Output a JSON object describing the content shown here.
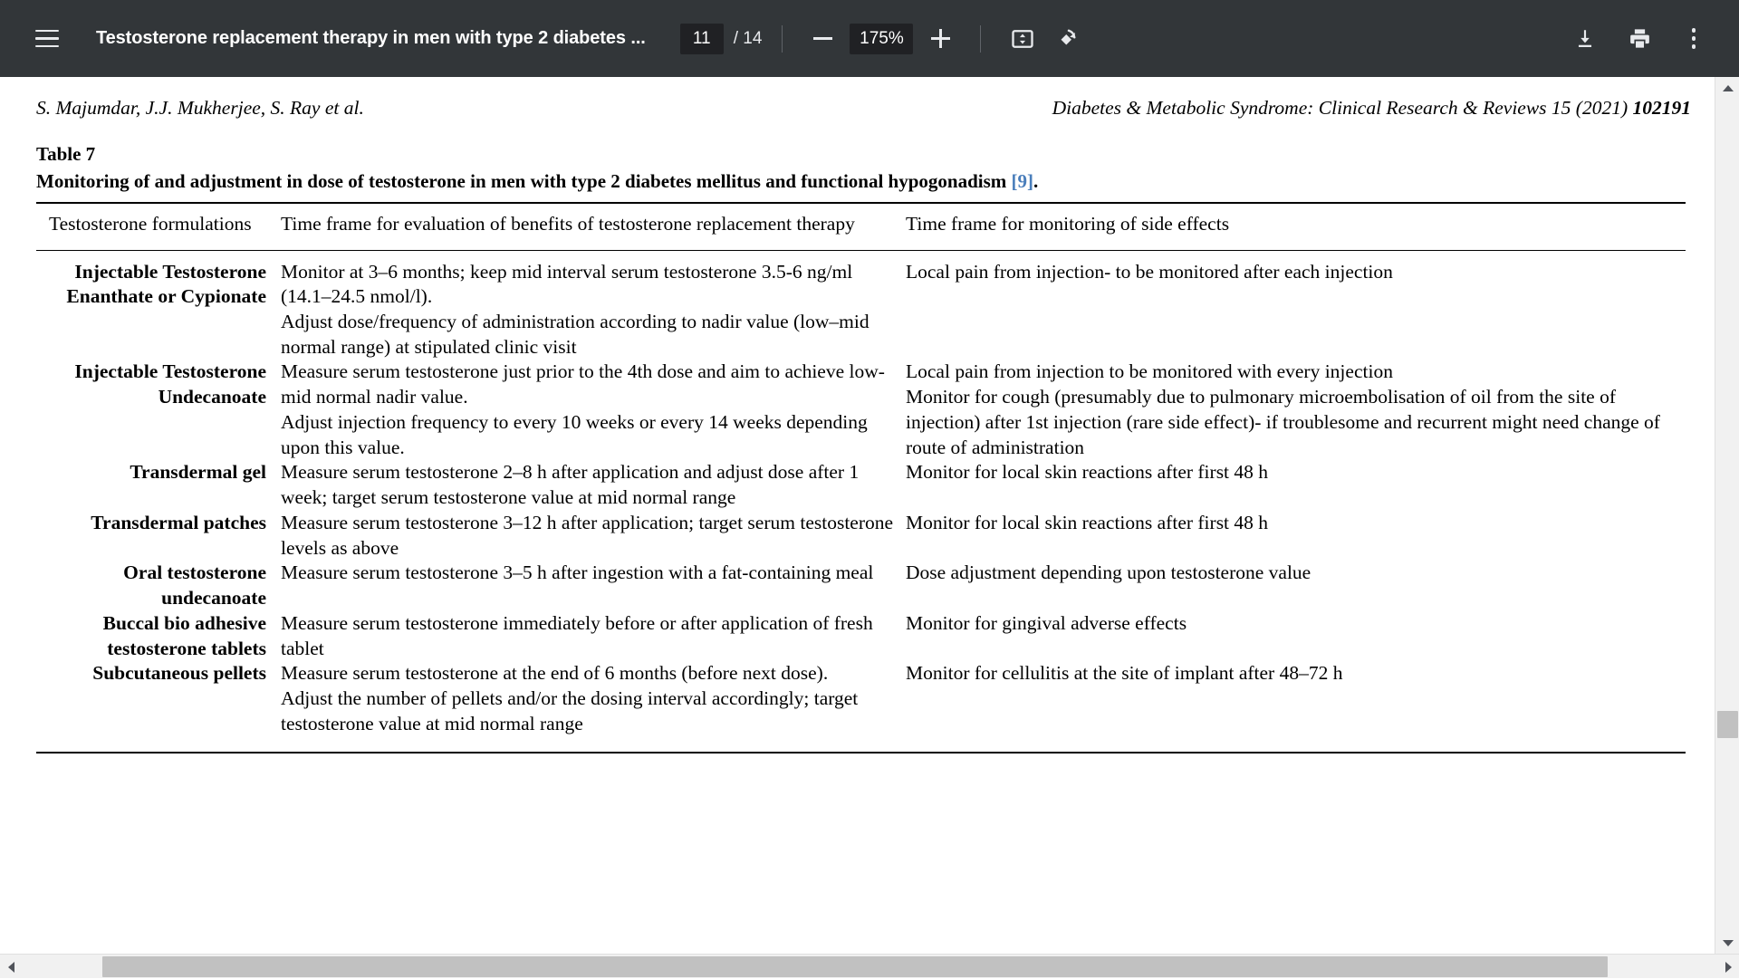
{
  "toolbar": {
    "menu_icon": "hamburger-menu-icon",
    "document_title": "Testosterone replacement therapy in men with type 2 diabetes ...",
    "page_number": "11",
    "page_count_label": "/ 14",
    "zoom_out_icon": "minus-icon",
    "zoom_level": "175%",
    "zoom_in_icon": "plus-icon",
    "fit_icon": "fit-to-page-icon",
    "rotate_icon": "rotate-icon",
    "download_icon": "download-icon",
    "print_icon": "print-icon",
    "more_icon": "kebab-more-icon",
    "background_color": "#323639",
    "field_background_color": "#202124"
  },
  "document": {
    "running_head": {
      "authors": "S. Majumdar, J.J. Mukherjee, S. Ray et al.",
      "journal_plain": "Diabetes & Metabolic Syndrome: Clinical Research & Reviews 15 (2021) ",
      "journal_article_id": "102191"
    },
    "table_label": "Table 7",
    "caption_text": "Monitoring of and adjustment in dose of testosterone in men with type 2 diabetes mellitus and functional hypogonadism ",
    "caption_reference": "[9]",
    "caption_suffix": ".",
    "reference_link_color": "#4a7ebb",
    "table": {
      "headers": [
        "Testosterone formulations",
        "Time frame for evaluation of benefits of testosterone replacement therapy",
        "Time frame for monitoring of side effects"
      ],
      "rows": [
        {
          "formulation": "Injectable Testosterone Enanthate or Cypionate",
          "benefit": "Monitor at 3–6 months; keep mid interval serum testosterone 3.5-6 ng/ml (14.1–24.5 nmol/l).\nAdjust dose/frequency of administration according to nadir value (low–mid normal range) at stipulated clinic visit",
          "side_effect": "Local pain from injection- to be monitored after each injection"
        },
        {
          "formulation": "Injectable Testosterone Undecanoate",
          "benefit": "Measure serum testosterone just prior to the 4th dose and aim to achieve low-mid normal nadir value.\nAdjust injection frequency to every 10 weeks or every 14 weeks depending upon this value.",
          "side_effect": "Local pain from injection to be monitored with every injection\nMonitor for cough (presumably due to pulmonary microembolisation of oil from the site of injection) after 1st injection (rare side effect)- if troublesome and recurrent might need change of route of administration"
        },
        {
          "formulation": "Transdermal gel",
          "benefit": "Measure serum testosterone 2–8 h after application and adjust dose after 1 week; target serum testosterone value at mid normal range",
          "side_effect": "Monitor for local skin reactions after first 48 h"
        },
        {
          "formulation": "Transdermal patches",
          "benefit": "Measure serum testosterone 3–12 h after application; target serum testosterone levels as above",
          "side_effect": "Monitor for local skin reactions after first 48 h"
        },
        {
          "formulation": "Oral testosterone undecanoate",
          "benefit": "Measure serum testosterone 3–5 h after ingestion with a fat-containing meal",
          "side_effect": "Dose adjustment depending upon testosterone value"
        },
        {
          "formulation": "Buccal bio adhesive testosterone tablets",
          "benefit": "Measure serum testosterone immediately before or after application of fresh tablet",
          "side_effect": "Monitor for gingival adverse effects"
        },
        {
          "formulation": "Subcutaneous pellets",
          "benefit": "Measure serum testosterone at the end of 6 months (before next dose).\nAdjust the number of pellets and/or the dosing interval accordingly; target testosterone value at mid normal range",
          "side_effect": "Monitor for cellulitis at the site of implant after 48–72 h"
        }
      ]
    }
  },
  "scrollbars": {
    "vertical_up_icon": "scroll-up-arrow-icon",
    "vertical_down_icon": "scroll-down-arrow-icon",
    "horizontal_left_icon": "scroll-left-arrow-icon",
    "horizontal_right_icon": "scroll-right-arrow-icon",
    "thumb_color": "#c1c1c1",
    "track_color": "#f1f1f1"
  }
}
